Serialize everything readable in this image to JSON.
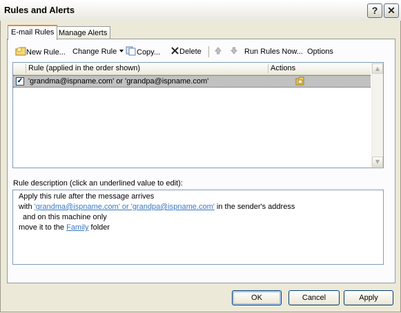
{
  "window": {
    "title": "Rules and Alerts",
    "help_label": "?",
    "close_label": "✕"
  },
  "tabs": [
    {
      "label": "E-mail Rules",
      "active": true
    },
    {
      "label": "Manage Alerts",
      "active": false
    }
  ],
  "toolbar": {
    "new_rule": "New Rule...",
    "change_rule": "Change Rule",
    "copy": "Copy...",
    "delete": "Delete",
    "run_rules_now": "Run Rules Now...",
    "options": "Options",
    "icons": [
      "new-rule-icon",
      "dropdown-arrow-icon",
      "copy-icon",
      "delete-x-icon",
      "move-up-icon",
      "move-down-icon"
    ]
  },
  "rules_list": {
    "columns": [
      "Rule (applied in the order shown)",
      "Actions"
    ],
    "rows": [
      {
        "checked": true,
        "name": "'grandma@ispname.com' or 'grandpa@ispname.com'",
        "action_icon": "move-to-folder-icon"
      }
    ]
  },
  "description": {
    "label": "Rule description (click an underlined value to edit):",
    "line1": "Apply this rule after the message arrives",
    "line2_prefix": "with ",
    "line2_link": "'grandma@ispname.com' or 'grandpa@ispname.com'",
    "line2_suffix": " in the sender's address",
    "line3": "and on this machine only",
    "line4_prefix": "move it to the ",
    "line4_link": "Family",
    "line4_suffix": " folder"
  },
  "buttons": {
    "ok": "OK",
    "cancel": "Cancel",
    "apply": "Apply"
  },
  "colors": {
    "dialog_bg": "#ece9d8",
    "selected_row": "#c1c1c1",
    "link": "#3d78c2",
    "tab_accent": "#e68b2c"
  }
}
